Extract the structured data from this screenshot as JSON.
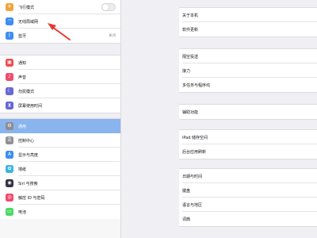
{
  "sidebar": {
    "top": [
      {
        "label": "飞行模式",
        "icon": "airplane-icon",
        "color": "#f2a43a",
        "glyph": "✈",
        "control": "toggle"
      },
      {
        "label": "无线局域网",
        "icon": "wifi-icon",
        "color": "#3d8ef0",
        "glyph": "◠"
      },
      {
        "label": "蓝牙",
        "icon": "bluetooth-icon",
        "color": "#3d8ef0",
        "glyph": "ᛒ",
        "value": "关闭"
      }
    ],
    "middle": [
      {
        "label": "通知",
        "icon": "notifications-icon",
        "color": "#f04b4b",
        "glyph": "▣"
      },
      {
        "label": "声音",
        "icon": "sound-icon",
        "color": "#f04b6b",
        "glyph": "♪"
      },
      {
        "label": "勿扰模式",
        "icon": "do-not-disturb-icon",
        "color": "#6767d6",
        "glyph": "☾"
      },
      {
        "label": "屏幕使用时间",
        "icon": "screen-time-icon",
        "color": "#6767d6",
        "glyph": "⧗"
      }
    ],
    "bottom": [
      {
        "label": "通用",
        "icon": "general-gear-icon",
        "color": "#8e8e93",
        "glyph": "⚙",
        "selected": true
      },
      {
        "label": "控制中心",
        "icon": "control-center-icon",
        "color": "#8e8e93",
        "glyph": "☰"
      },
      {
        "label": "显示与亮度",
        "icon": "display-brightness-icon",
        "color": "#3d8ef0",
        "glyph": "A"
      },
      {
        "label": "墙纸",
        "icon": "wallpaper-icon",
        "color": "#3bb5e8",
        "glyph": "✿"
      },
      {
        "label": "Siri 与搜索",
        "icon": "siri-icon",
        "color": "#333344",
        "glyph": "◉"
      },
      {
        "label": "触控 ID 与密码",
        "icon": "touch-id-icon",
        "color": "#f04b6b",
        "glyph": "◎"
      },
      {
        "label": "电池",
        "icon": "battery-icon",
        "color": "#4cd964",
        "glyph": "▭"
      }
    ]
  },
  "main": {
    "groups": [
      [
        "关于本机",
        "软件更新"
      ],
      [
        "隔空投送",
        "接力",
        "多任务与程序坞"
      ],
      [
        "辅助功能"
      ],
      [
        "iPad 储存空间",
        "后台应用刷新"
      ],
      [
        "日期与时间",
        "键盘",
        "语言与地区",
        "词典"
      ]
    ]
  },
  "annotation": {
    "color": "#e8382f"
  }
}
